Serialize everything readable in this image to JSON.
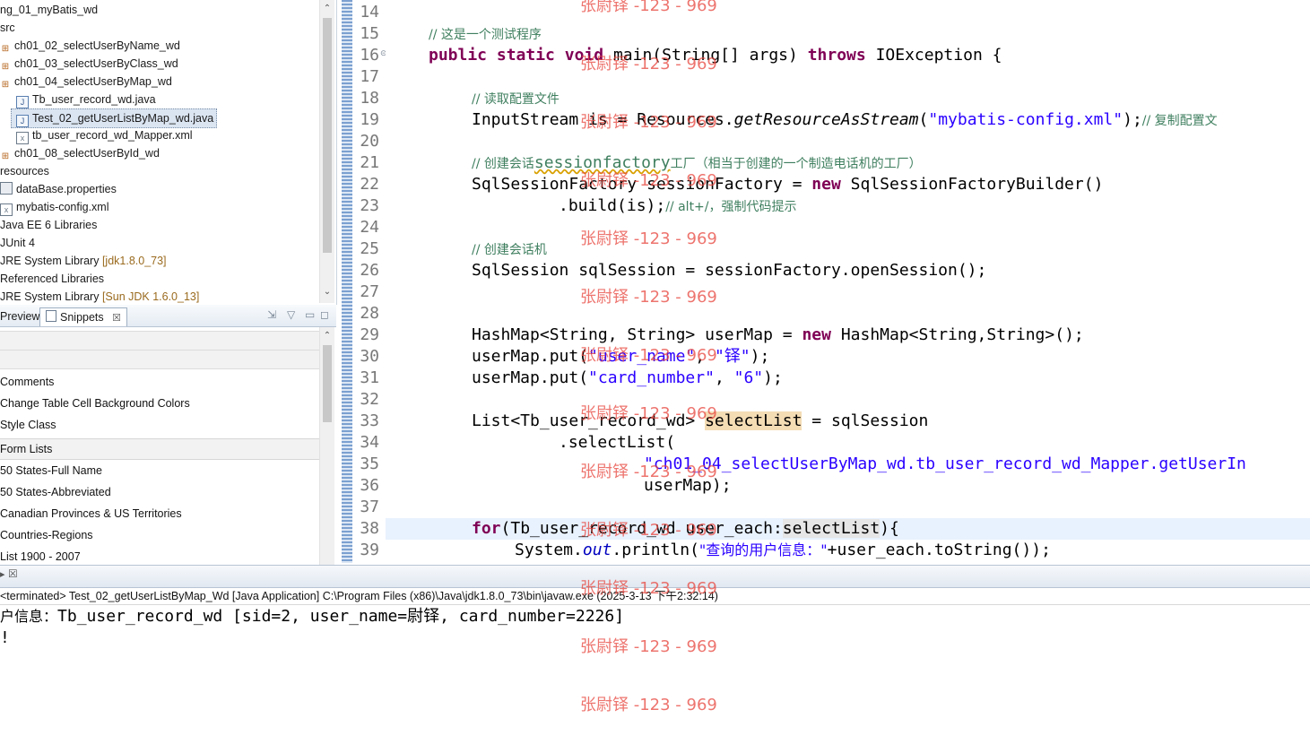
{
  "explorer": {
    "items": [
      {
        "label": "ng_01_myBatis_wd",
        "icon": "folder-icon"
      },
      {
        "label": "src",
        "icon": "source-folder-icon"
      },
      {
        "label": "ch01_02_selectUserByName_wd",
        "icon": "package-icon"
      },
      {
        "label": "ch01_03_selectUserByClass_wd",
        "icon": "package-icon"
      },
      {
        "label": "ch01_04_selectUserByMap_wd",
        "icon": "package-icon"
      },
      {
        "label": "Tb_user_record_wd.java",
        "icon": "java-file-icon"
      },
      {
        "label": "Test_02_getUserListByMap_wd.java",
        "icon": "java-file-icon"
      },
      {
        "label": "tb_user_record_wd_Mapper.xml",
        "icon": "xml-file-icon"
      },
      {
        "label": "ch01_08_selectUserById_wd",
        "icon": "package-icon"
      },
      {
        "label": "resources",
        "icon": "folder-icon"
      },
      {
        "label": "dataBase.properties",
        "icon": "properties-file-icon"
      },
      {
        "label": "mybatis-config.xml",
        "icon": "xml-file-icon"
      },
      {
        "label": "Java EE 6 Libraries",
        "icon": "library-icon"
      },
      {
        "label": "JUnit 4",
        "icon": "library-icon"
      },
      {
        "label": "JRE System Library",
        "version": "[jdk1.8.0_73]",
        "icon": "library-icon"
      },
      {
        "label": "Referenced Libraries",
        "icon": "library-icon"
      },
      {
        "label": "JRE System Library",
        "version": "[Sun JDK 1.6.0_13]",
        "icon": "library-icon"
      }
    ]
  },
  "snippets_view": {
    "tabs": [
      {
        "label": "Preview"
      },
      {
        "label": "Snippets"
      }
    ],
    "rows": [
      {
        "label": "Comments"
      },
      {
        "label": "Change Table Cell Background Colors"
      },
      {
        "label": "Style Class"
      },
      {
        "label": "Form Lists"
      },
      {
        "label": "50 States-Full Name"
      },
      {
        "label": "50 States-Abbreviated"
      },
      {
        "label": "Canadian Provinces & US Territories"
      },
      {
        "label": "Countries-Regions"
      },
      {
        "label": "List 1900 - 2007"
      }
    ]
  },
  "editor": {
    "line_numbers": [
      "14",
      "15",
      "16",
      "17",
      "18",
      "19",
      "20",
      "21",
      "22",
      "23",
      "24",
      "25",
      "26",
      "27",
      "28",
      "29",
      "30",
      "31",
      "32",
      "33",
      "34",
      "35",
      "36",
      "37",
      "38",
      "39"
    ],
    "code": {
      "l15_comment": "// 这是一个测试程序",
      "l16_public": "public",
      "l16_static": "static",
      "l16_void": "void",
      "l16_sig": "main(String[] args)",
      "l16_throws": "throws",
      "l16_rest": "IOException {",
      "l18_comment": "// 读取配置文件",
      "l19_a": "InputStream is = Resources.",
      "l19_method": "getResourceAsStream",
      "l19_paren": "(",
      "l19_str": "\"mybatis-config.xml\"",
      "l19_b": ");",
      "l19_comment": "// 复制配置文",
      "l21_comment_a": "// 创建会话",
      "l21_comment_b": "sessionfactory",
      "l21_comment_c": "工厂（相当于创建的一个制造电话机的工厂）",
      "l22_a": "SqlSessionFactory sessionFactory = ",
      "l22_new": "new",
      "l22_b": " SqlSessionFactoryBuilder()",
      "l23_a": ".build(is);",
      "l23_comment": "// alt+/，强制代码提示",
      "l25_comment": "// 创建会话机",
      "l26_a": "SqlSession sqlSession = sessionFactory.openSession();",
      "l29_a": "HashMap<String, String> userMap = ",
      "l29_new": "new",
      "l29_b": " HashMap<String,String>();",
      "l30_a": "userMap.put(",
      "l30_str1": "\"user_name\"",
      "l30_b": ", ",
      "l30_str2": "\"铎\"",
      "l30_c": ");",
      "l31_a": "userMap.put(",
      "l31_str1": "\"card_number\"",
      "l31_b": ", ",
      "l31_str2": "\"6\"",
      "l31_c": ");",
      "l33_a": "List<Tb_user_record_wd> ",
      "l33_var": "selectList",
      "l33_b": " = sqlSession",
      "l34_a": ".selectList(",
      "l35_str": "\"ch01_04_selectUserByMap_wd.tb_user_record_wd_Mapper.getUserIn",
      "l36_a": "userMap);",
      "l38_for": "for",
      "l38_a": "(Tb_user_record_wd user_each:",
      "l38_var": "selectList",
      "l38_b": "){",
      "l39_a": "System.",
      "l39_out": "out",
      "l39_b": ".println(",
      "l39_str": "\"查询的用户信息：\"",
      "l39_c": "+user_each.toString());"
    }
  },
  "console": {
    "description": "<terminated> Test_02_getUserListByMap_Wd [Java Application] C:\\Program Files (x86)\\Java\\jdk1.8.0_73\\bin\\javaw.exe (2025-3-13 下午2:32:14)",
    "line1_prefix": "户信息：",
    "line1_rest": "Tb_user_record_wd [sid=2, user_name=尉铎, card_number=2226]",
    "line2": "!"
  },
  "watermark": {
    "text": "张尉铎 -123 - 969"
  },
  "colors": {
    "keyword": "#7f0055",
    "comment": "#3f7f5f",
    "string": "#2a00ff",
    "field": "#0000c0",
    "current_line": "#e8f2fe",
    "occurrence": "#f4dcb5",
    "watermark": "#e8463e"
  }
}
